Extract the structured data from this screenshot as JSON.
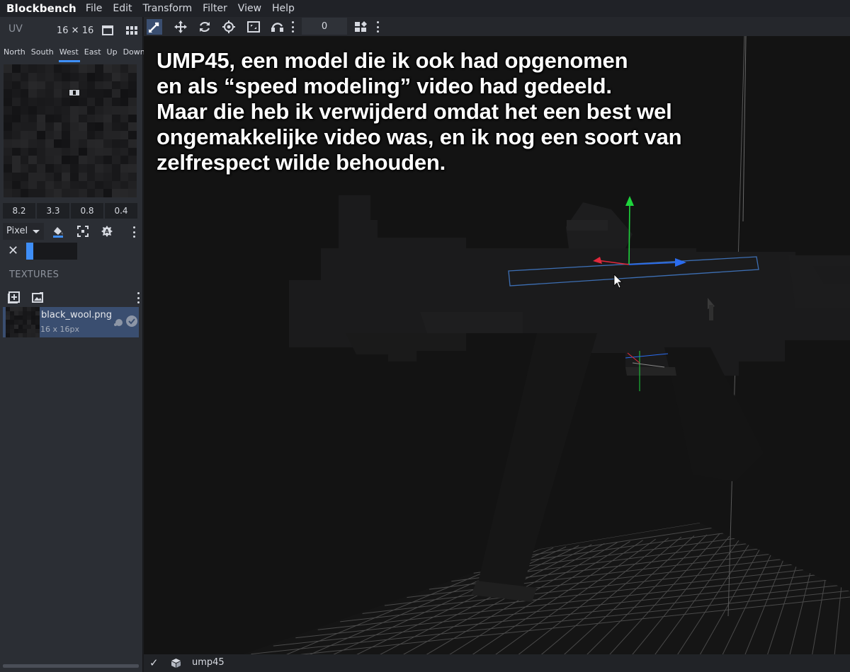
{
  "app": {
    "title": "Blockbench"
  },
  "menu": [
    "File",
    "Edit",
    "Transform",
    "Filter",
    "View",
    "Help"
  ],
  "uv_panel": {
    "title": "UV",
    "size": "16 ✕ 16",
    "faces": [
      "North",
      "South",
      "West",
      "East",
      "Up",
      "Down"
    ],
    "active_face": "West",
    "coords": [
      "8.2",
      "3.3",
      "0.8",
      "0.4"
    ],
    "paint_mode": "Pixel"
  },
  "textures": {
    "title": "TEXTURES",
    "items": [
      {
        "name": "black_wool.png",
        "dimensions": "16 x 16px"
      }
    ]
  },
  "toolbar": {
    "value": "0"
  },
  "overlay": {
    "lines": [
      "UMP45, een model die ik ook had opgenomen",
      "en als “speed modeling” video had gedeeld.",
      "Maar die heb ik verwijderd omdat het een best wel",
      "ongemakkelijke video was, en ik nog een soort van",
      "zelfrespect wilde behouden."
    ]
  },
  "status": {
    "model_name": "ump45"
  },
  "colors": {
    "accent": "#3e90ff",
    "axis_x": "#e2283c",
    "axis_y": "#1ed43c",
    "axis_z": "#2a6cf0",
    "selection": "#3d6fb4"
  }
}
